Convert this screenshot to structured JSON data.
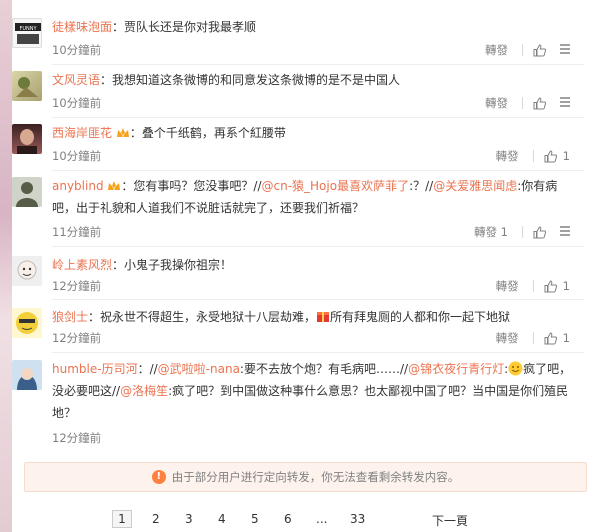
{
  "comments": [
    {
      "user": "徒樣味泡面",
      "text": "：贾队长还是你对我最孝顺",
      "time": "10分鐘前",
      "repost": "轉發",
      "likes": "",
      "avatar_color": "#f4f4f4",
      "avatar_text": "我是贾队长 FUNNY"
    },
    {
      "user": "文风灵语",
      "text": "：我想知道这条微博的和同意发这条微博的是不是中国人",
      "time": "10分鐘前",
      "repost": "轉發",
      "likes": "",
      "avatar_color": "#c9c290"
    },
    {
      "user": "西海岸匪花",
      "text": "：叠个千纸鹤，再系个紅腰带",
      "time": "10分鐘前",
      "repost": "轉發",
      "likes": "1",
      "avatar_color": "#6e3a3a"
    },
    {
      "user": "anyblind",
      "text_parts": [
        "：您有事吗？您没事吧？//",
        "@cn-猿_Hojo最喜欢萨菲了",
        ":？//",
        "@关爱雅思闻虑",
        ":你有病吧，出于礼貌和人道我们不说脏话就完了，还要我们祈福？"
      ],
      "time": "11分鐘前",
      "repost": "轉發 1",
      "likes": "",
      "avatar_color": "#6a7060"
    },
    {
      "user": "岭上素风烈",
      "text": "：小鬼子我操你祖宗！",
      "time": "12分鐘前",
      "repost": "轉發",
      "likes": "1",
      "avatar_color": "#e6e6e6"
    },
    {
      "user": "狼剑士",
      "text_parts": [
        "：祝永世不得超生，永受地狱十八层劫难，",
        "所有拜鬼厕的人都和你一起下地狱"
      ],
      "time": "12分鐘前",
      "repost": "轉發",
      "likes": "1",
      "avatar_color": "#f3cf3a"
    },
    {
      "user": "humble-历司河",
      "text_parts": [
        "：//",
        "@武啦啦-nana",
        ":要不去放个炮？有毛病吧……//",
        "@锦衣夜行青行灯",
        ":",
        "疯了吧，没必要吧这//",
        "@洛梅笙",
        ":疯了吧？到中国做这种事什么意思？也太鄙视中国了吧？当中国是你们殖民地？"
      ],
      "time": "12分鐘前",
      "repost": "",
      "likes": "",
      "avatar_color": "#5b86b8"
    }
  ],
  "notice": "由于部分用户进行定向转发，你无法查看剩余转发内容。",
  "pagination": {
    "pages": [
      "1",
      "2",
      "3",
      "4",
      "5",
      "6",
      "...",
      "33"
    ],
    "current": "1",
    "next": "下一頁"
  },
  "colors": {
    "accent": "#eb7350",
    "meta": "#808080"
  }
}
